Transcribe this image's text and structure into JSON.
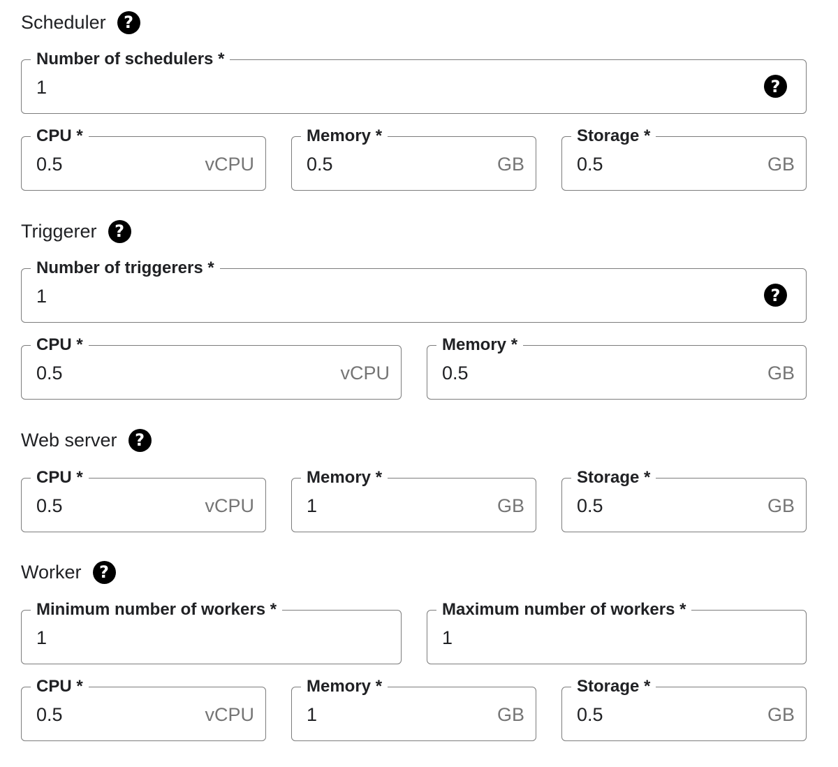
{
  "scheduler": {
    "heading": "Scheduler",
    "count": {
      "label": "Number of schedulers *",
      "value": "1"
    },
    "cpu": {
      "label": "CPU *",
      "value": "0.5",
      "unit": "vCPU"
    },
    "memory": {
      "label": "Memory *",
      "value": "0.5",
      "unit": "GB"
    },
    "storage": {
      "label": "Storage *",
      "value": "0.5",
      "unit": "GB"
    }
  },
  "triggerer": {
    "heading": "Triggerer",
    "count": {
      "label": "Number of triggerers *",
      "value": "1"
    },
    "cpu": {
      "label": "CPU *",
      "value": "0.5",
      "unit": "vCPU"
    },
    "memory": {
      "label": "Memory *",
      "value": "0.5",
      "unit": "GB"
    }
  },
  "webserver": {
    "heading": "Web server",
    "cpu": {
      "label": "CPU *",
      "value": "0.5",
      "unit": "vCPU"
    },
    "memory": {
      "label": "Memory *",
      "value": "1",
      "unit": "GB"
    },
    "storage": {
      "label": "Storage *",
      "value": "0.5",
      "unit": "GB"
    }
  },
  "worker": {
    "heading": "Worker",
    "min": {
      "label": "Minimum number of workers *",
      "value": "1"
    },
    "max": {
      "label": "Maximum number of workers *",
      "value": "1"
    },
    "cpu": {
      "label": "CPU *",
      "value": "0.5",
      "unit": "vCPU"
    },
    "memory": {
      "label": "Memory *",
      "value": "1",
      "unit": "GB"
    },
    "storage": {
      "label": "Storage *",
      "value": "0.5",
      "unit": "GB"
    }
  },
  "icons": {
    "help": "help-circle-icon",
    "help_glyph": "?"
  }
}
